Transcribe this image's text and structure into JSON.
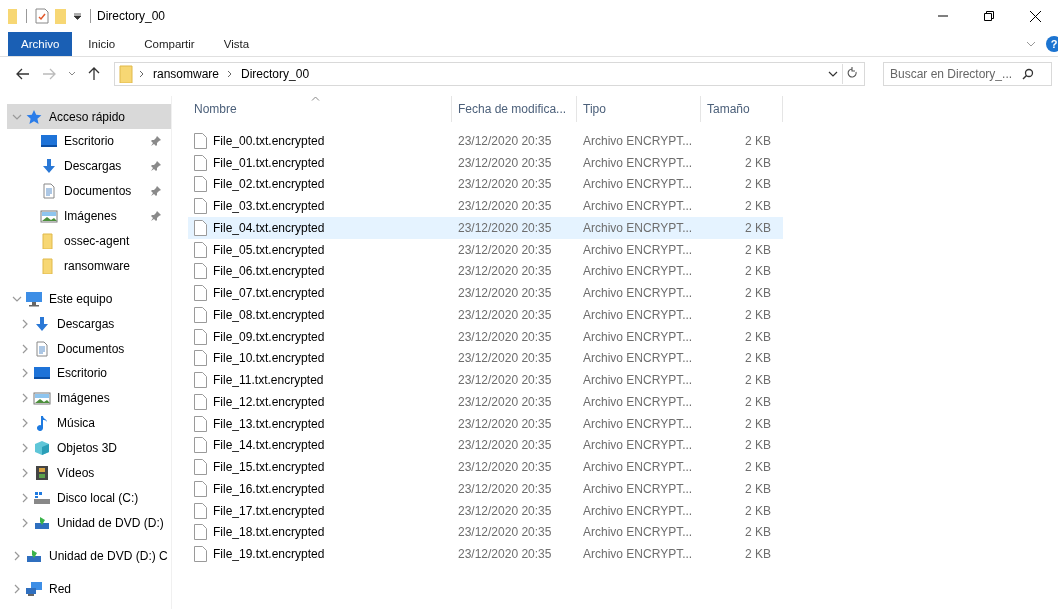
{
  "window": {
    "title": "Directory_00"
  },
  "ribbon": {
    "tabs": [
      {
        "label": "Archivo",
        "selected": true
      },
      {
        "label": "Inicio",
        "selected": false
      },
      {
        "label": "Compartir",
        "selected": false
      },
      {
        "label": "Vista",
        "selected": false
      }
    ],
    "help": "?"
  },
  "navigation": {
    "back_disabled": false,
    "forward_disabled": true
  },
  "address": {
    "path": [
      "ransomware",
      "Directory_00"
    ]
  },
  "search": {
    "placeholder": "Buscar en Directory_..."
  },
  "sidebar": {
    "items": [
      {
        "label": "Acceso rápido",
        "kind": "star",
        "expanded": true,
        "selected": true,
        "children": [
          {
            "label": "Escritorio",
            "kind": "desktop",
            "pinned": true
          },
          {
            "label": "Descargas",
            "kind": "download",
            "pinned": true
          },
          {
            "label": "Documentos",
            "kind": "document",
            "pinned": true
          },
          {
            "label": "Imágenes",
            "kind": "pictures",
            "pinned": true
          },
          {
            "label": "ossec-agent",
            "kind": "folder",
            "pinned": false
          },
          {
            "label": "ransomware",
            "kind": "folder",
            "pinned": false
          }
        ]
      },
      {
        "label": "Este equipo",
        "kind": "pc",
        "expanded": true,
        "selected": false,
        "children": [
          {
            "label": "Descargas",
            "kind": "download",
            "expanded": false
          },
          {
            "label": "Documentos",
            "kind": "document",
            "expanded": false
          },
          {
            "label": "Escritorio",
            "kind": "desktop",
            "expanded": false
          },
          {
            "label": "Imágenes",
            "kind": "pictures",
            "expanded": false
          },
          {
            "label": "Música",
            "kind": "music",
            "expanded": false
          },
          {
            "label": "Objetos 3D",
            "kind": "cube",
            "expanded": false
          },
          {
            "label": "Vídeos",
            "kind": "video",
            "expanded": false
          },
          {
            "label": "Disco local (C:)",
            "kind": "disk",
            "expanded": false
          },
          {
            "label": "Unidad de DVD (D:)",
            "kind": "dvd",
            "expanded": false
          }
        ]
      },
      {
        "label": "Unidad de DVD (D:) C",
        "kind": "dvd",
        "expanded": false,
        "selected": false
      },
      {
        "label": "Red",
        "kind": "network",
        "expanded": false,
        "selected": false
      }
    ]
  },
  "table": {
    "columns": [
      {
        "label": "Nombre",
        "sorted": true
      },
      {
        "label": "Fecha de modifica...",
        "sorted": false
      },
      {
        "label": "Tipo",
        "sorted": false
      },
      {
        "label": "Tamaño",
        "sorted": false
      }
    ],
    "rows": [
      {
        "name": "File_00.txt.encrypted",
        "modified": "23/12/2020 20:35",
        "type": "Archivo ENCRYPT...",
        "size": "2 KB",
        "hovered": false
      },
      {
        "name": "File_01.txt.encrypted",
        "modified": "23/12/2020 20:35",
        "type": "Archivo ENCRYPT...",
        "size": "2 KB",
        "hovered": false
      },
      {
        "name": "File_02.txt.encrypted",
        "modified": "23/12/2020 20:35",
        "type": "Archivo ENCRYPT...",
        "size": "2 KB",
        "hovered": false
      },
      {
        "name": "File_03.txt.encrypted",
        "modified": "23/12/2020 20:35",
        "type": "Archivo ENCRYPT...",
        "size": "2 KB",
        "hovered": false
      },
      {
        "name": "File_04.txt.encrypted",
        "modified": "23/12/2020 20:35",
        "type": "Archivo ENCRYPT...",
        "size": "2 KB",
        "hovered": true
      },
      {
        "name": "File_05.txt.encrypted",
        "modified": "23/12/2020 20:35",
        "type": "Archivo ENCRYPT...",
        "size": "2 KB",
        "hovered": false
      },
      {
        "name": "File_06.txt.encrypted",
        "modified": "23/12/2020 20:35",
        "type": "Archivo ENCRYPT...",
        "size": "2 KB",
        "hovered": false
      },
      {
        "name": "File_07.txt.encrypted",
        "modified": "23/12/2020 20:35",
        "type": "Archivo ENCRYPT...",
        "size": "2 KB",
        "hovered": false
      },
      {
        "name": "File_08.txt.encrypted",
        "modified": "23/12/2020 20:35",
        "type": "Archivo ENCRYPT...",
        "size": "2 KB",
        "hovered": false
      },
      {
        "name": "File_09.txt.encrypted",
        "modified": "23/12/2020 20:35",
        "type": "Archivo ENCRYPT...",
        "size": "2 KB",
        "hovered": false
      },
      {
        "name": "File_10.txt.encrypted",
        "modified": "23/12/2020 20:35",
        "type": "Archivo ENCRYPT...",
        "size": "2 KB",
        "hovered": false
      },
      {
        "name": "File_11.txt.encrypted",
        "modified": "23/12/2020 20:35",
        "type": "Archivo ENCRYPT...",
        "size": "2 KB",
        "hovered": false
      },
      {
        "name": "File_12.txt.encrypted",
        "modified": "23/12/2020 20:35",
        "type": "Archivo ENCRYPT...",
        "size": "2 KB",
        "hovered": false
      },
      {
        "name": "File_13.txt.encrypted",
        "modified": "23/12/2020 20:35",
        "type": "Archivo ENCRYPT...",
        "size": "2 KB",
        "hovered": false
      },
      {
        "name": "File_14.txt.encrypted",
        "modified": "23/12/2020 20:35",
        "type": "Archivo ENCRYPT...",
        "size": "2 KB",
        "hovered": false
      },
      {
        "name": "File_15.txt.encrypted",
        "modified": "23/12/2020 20:35",
        "type": "Archivo ENCRYPT...",
        "size": "2 KB",
        "hovered": false
      },
      {
        "name": "File_16.txt.encrypted",
        "modified": "23/12/2020 20:35",
        "type": "Archivo ENCRYPT...",
        "size": "2 KB",
        "hovered": false
      },
      {
        "name": "File_17.txt.encrypted",
        "modified": "23/12/2020 20:35",
        "type": "Archivo ENCRYPT...",
        "size": "2 KB",
        "hovered": false
      },
      {
        "name": "File_18.txt.encrypted",
        "modified": "23/12/2020 20:35",
        "type": "Archivo ENCRYPT...",
        "size": "2 KB",
        "hovered": false
      },
      {
        "name": "File_19.txt.encrypted",
        "modified": "23/12/2020 20:35",
        "type": "Archivo ENCRYPT...",
        "size": "2 KB",
        "hovered": false
      }
    ]
  }
}
